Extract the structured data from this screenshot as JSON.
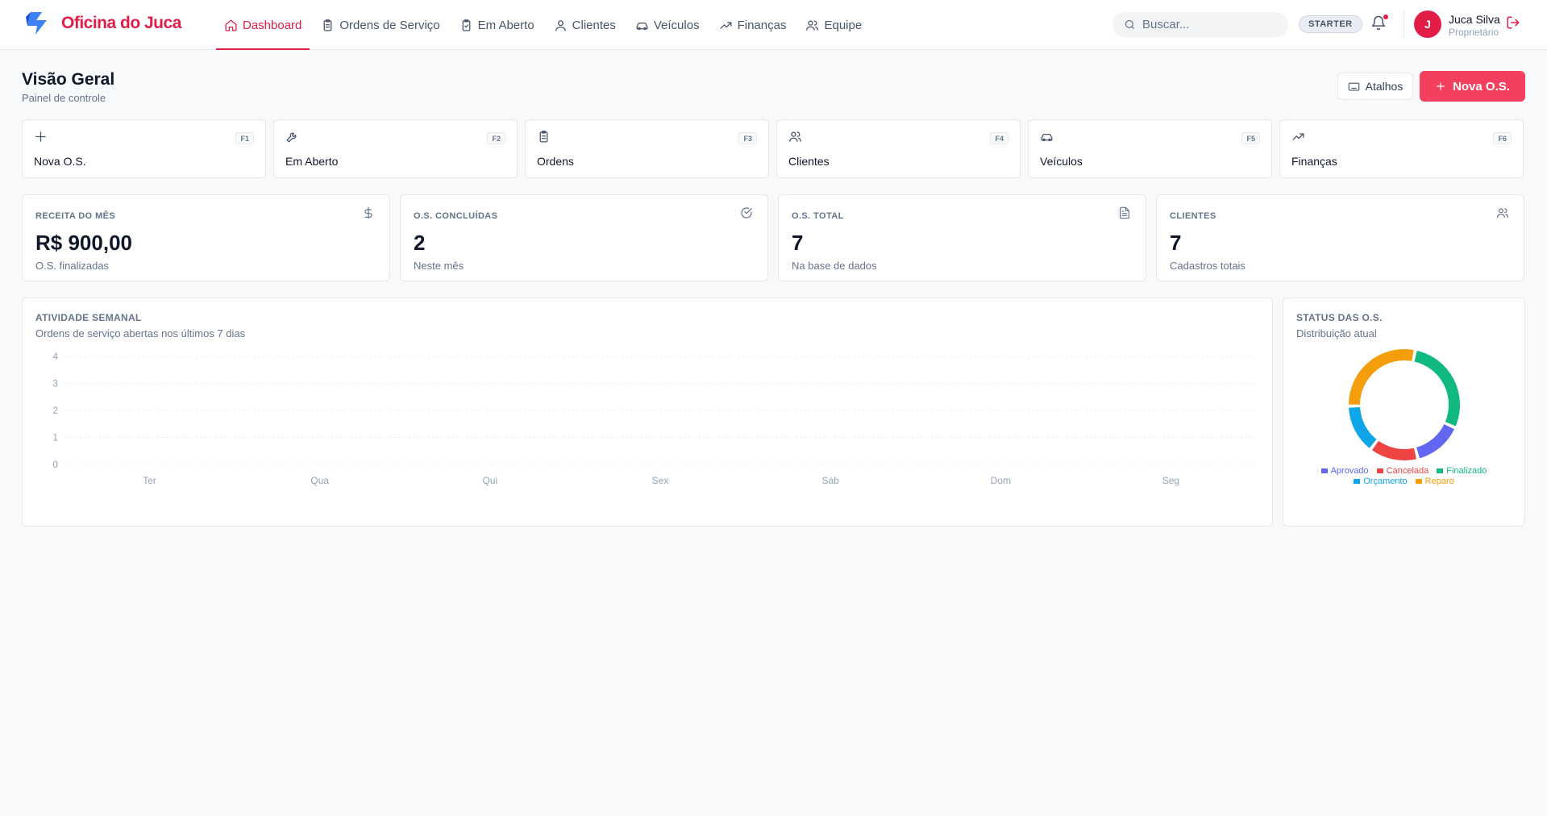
{
  "app": {
    "brand": "Oficina do Juca"
  },
  "nav": [
    {
      "id": "dashboard",
      "label": "Dashboard",
      "icon": "home-icon",
      "active": true
    },
    {
      "id": "ordens",
      "label": "Ordens de Serviço",
      "icon": "clipboard-icon",
      "active": false
    },
    {
      "id": "aberto",
      "label": "Em Aberto",
      "icon": "clipboard-check-icon",
      "active": false
    },
    {
      "id": "clientes",
      "label": "Clientes",
      "icon": "user-icon",
      "active": false
    },
    {
      "id": "veiculos",
      "label": "Veículos",
      "icon": "car-icon",
      "active": false
    },
    {
      "id": "financas",
      "label": "Finanças",
      "icon": "trending-up-icon",
      "active": false
    },
    {
      "id": "equipe",
      "label": "Equipe",
      "icon": "users-icon",
      "active": false
    }
  ],
  "header": {
    "search_placeholder": "Buscar...",
    "plan": "STARTER",
    "user": {
      "initial": "J",
      "name": "Juca Silva",
      "role": "Proprietário"
    }
  },
  "page": {
    "title": "Visão Geral",
    "subtitle": "Painel de controle",
    "shortcuts_button": "Atalhos",
    "new_button": "Nova O.S."
  },
  "shortcuts": [
    {
      "label": "Nova O.S.",
      "key": "F1",
      "icon": "plus-icon"
    },
    {
      "label": "Em Aberto",
      "key": "F2",
      "icon": "wrench-icon"
    },
    {
      "label": "Ordens",
      "key": "F3",
      "icon": "clipboard-icon"
    },
    {
      "label": "Clientes",
      "key": "F4",
      "icon": "users-icon"
    },
    {
      "label": "Veículos",
      "key": "F5",
      "icon": "car-icon"
    },
    {
      "label": "Finanças",
      "key": "F6",
      "icon": "trending-up-icon"
    }
  ],
  "stats": [
    {
      "label": "RECEITA DO MÊS",
      "value": "R$ 900,00",
      "sub": "O.S. finalizadas",
      "icon": "dollar-icon"
    },
    {
      "label": "O.S. CONCLUÍDAS",
      "value": "2",
      "sub": "Neste mês",
      "icon": "check-circle-icon"
    },
    {
      "label": "O.S. TOTAL",
      "value": "7",
      "sub": "Na base de dados",
      "icon": "file-text-icon"
    },
    {
      "label": "CLIENTES",
      "value": "7",
      "sub": "Cadastros totais",
      "icon": "users-icon"
    }
  ],
  "weekly": {
    "title": "ATIVIDADE SEMANAL",
    "subtitle": "Ordens de serviço abertas nos últimos 7 dias"
  },
  "status": {
    "title": "STATUS DAS O.S.",
    "subtitle": "Distribuição atual"
  },
  "chart_data": [
    {
      "type": "bar",
      "title": "ATIVIDADE SEMANAL",
      "categories": [
        "Ter",
        "Qua",
        "Qui",
        "Sex",
        "Sáb",
        "Dom",
        "Seg"
      ],
      "values": [
        0,
        0,
        0,
        0,
        0,
        0,
        0
      ],
      "yticks": [
        "4",
        "3",
        "2",
        "1",
        "0"
      ],
      "ylim": [
        0,
        4
      ],
      "grid": true
    },
    {
      "type": "pie",
      "title": "STATUS DAS O.S.",
      "donut": true,
      "legend_position": "bottom",
      "slices": [
        {
          "name": "Finalizado",
          "value": 2,
          "color": "#10b981"
        },
        {
          "name": "Aprovado",
          "value": 1,
          "color": "#6366f1"
        },
        {
          "name": "Cancelada",
          "value": 1,
          "color": "#ef4444"
        },
        {
          "name": "Orçamento",
          "value": 1,
          "color": "#0ea5e9"
        },
        {
          "name": "Reparo",
          "value": 2,
          "color": "#f59e0b"
        }
      ],
      "legend_order": [
        "Aprovado",
        "Cancelada",
        "Finalizado",
        "Orçamento",
        "Reparo"
      ]
    }
  ]
}
